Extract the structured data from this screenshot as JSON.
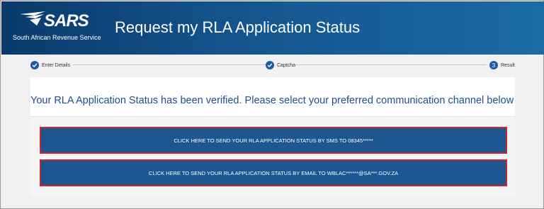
{
  "header": {
    "logo_text": "SARS",
    "org_name": "South African Revenue Service",
    "title": "Request my RLA Application Status"
  },
  "steps": [
    {
      "label": "Enter Details",
      "marker": "check"
    },
    {
      "label": "Captcha",
      "marker": "check"
    },
    {
      "label": "Result",
      "marker": "3"
    }
  ],
  "main": {
    "message": "Your RLA Application Status has been verified.  Please select your preferred communication channel below",
    "sms_button": "CLICK HERE TO SEND YOUR RLA APPLICATION  STATUS BY SMS TO 08345*****",
    "email_button": "CLICK HERE TO SEND YOUR RLA APPLICATION STATUS BY EMAIL TO WBLAC******@SA***.GOV.ZA"
  },
  "colors": {
    "header_dark": "#0b3a6b",
    "header_light": "#1b6aa6",
    "button": "#1c5791",
    "button_border": "#d2232a",
    "message_text": "#1f4e8c",
    "step_accent": "#1f5aa6"
  }
}
